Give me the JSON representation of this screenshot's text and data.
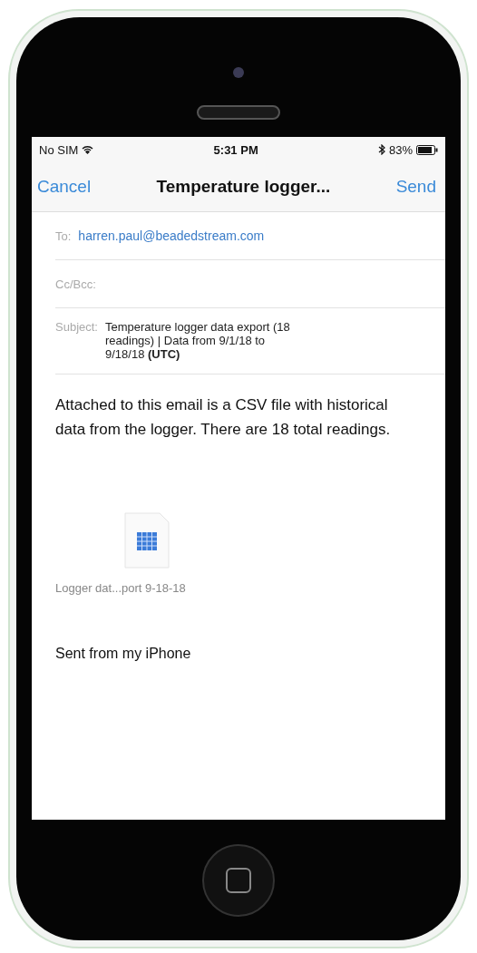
{
  "status_bar": {
    "carrier": "No SIM",
    "time": "5:31 PM",
    "battery": "83%"
  },
  "nav_bar": {
    "cancel": "Cancel",
    "title": "Temperature logger...",
    "send": "Send"
  },
  "fields": [
    {
      "label": "To:",
      "value": "harren.paul@beadedstream.com",
      "kind": "recipient"
    },
    {
      "label": "Cc/Bcc:",
      "kind": "empty"
    },
    {
      "label": "Subject:",
      "value": "Temperature logger data export (18 readings) | Data from 9/1/18 to 9/18/18 **(UTC)**",
      "kind": "subject"
    }
  ],
  "body": "Attached to this email is a CSV file with historical data from the logger. There are 18 total readings.",
  "attachment": {
    "name": "Logger dat...port 9-18-18"
  },
  "signature": "Sent from my iPhone"
}
